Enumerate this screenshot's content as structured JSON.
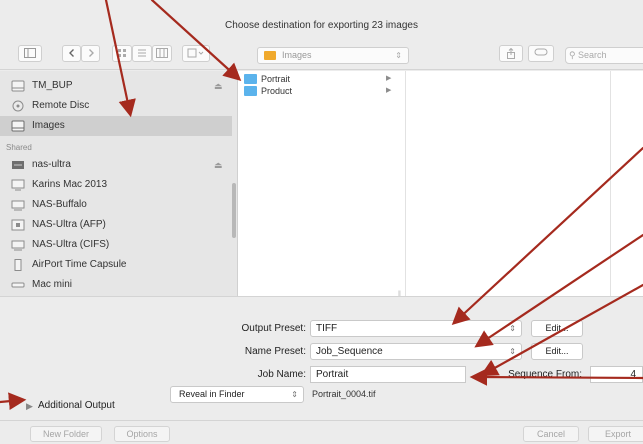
{
  "dialog": {
    "title": "Choose destination for exporting 23 images"
  },
  "toolbar": {
    "location": "Images",
    "search_placeholder": "Search"
  },
  "sidebar": {
    "devices": [
      {
        "label": "TM_BUP",
        "icon": "drive-icon",
        "ejectable": true
      },
      {
        "label": "Remote Disc",
        "icon": "disc-icon",
        "ejectable": false
      },
      {
        "label": "Images",
        "icon": "drive-icon",
        "ejectable": false,
        "selected": true
      }
    ],
    "shared_heading": "Shared",
    "shared": [
      {
        "label": "nas-ultra",
        "icon": "server-icon",
        "ejectable": true
      },
      {
        "label": "Karins Mac 2013",
        "icon": "computer-icon"
      },
      {
        "label": "NAS-Buffalo",
        "icon": "network-drive-icon"
      },
      {
        "label": "NAS-Ultra (AFP)",
        "icon": "network-drive-icon"
      },
      {
        "label": "NAS-Ultra (CIFS)",
        "icon": "network-drive-icon"
      },
      {
        "label": "AirPort Time Capsule",
        "icon": "time-capsule-icon"
      },
      {
        "label": "Mac mini",
        "icon": "mac-mini-icon"
      }
    ]
  },
  "browser": {
    "folders": [
      {
        "label": "Portrait"
      },
      {
        "label": "Product"
      }
    ]
  },
  "options": {
    "output_preset_label": "Output Preset:",
    "output_preset_value": "TIFF",
    "name_preset_label": "Name Preset:",
    "name_preset_value": "Job_Sequence",
    "job_name_label": "Job Name:",
    "job_name_value": "Portrait",
    "sequence_from_label": "Sequence From:",
    "sequence_from_value": "4",
    "edit_label": "Edit...",
    "reveal_value": "Reveal in Finder",
    "filename_preview": "Portrait_0004.tif",
    "additional_output_label": "Additional Output"
  },
  "footer": {
    "new_folder": "New Folder",
    "options": "Options",
    "cancel": "Cancel",
    "export": "Export"
  },
  "colors": {
    "annotation_arrow": "#a52a1e",
    "folder_blue": "#5bb3ec",
    "folder_orange": "#f0a92c"
  }
}
